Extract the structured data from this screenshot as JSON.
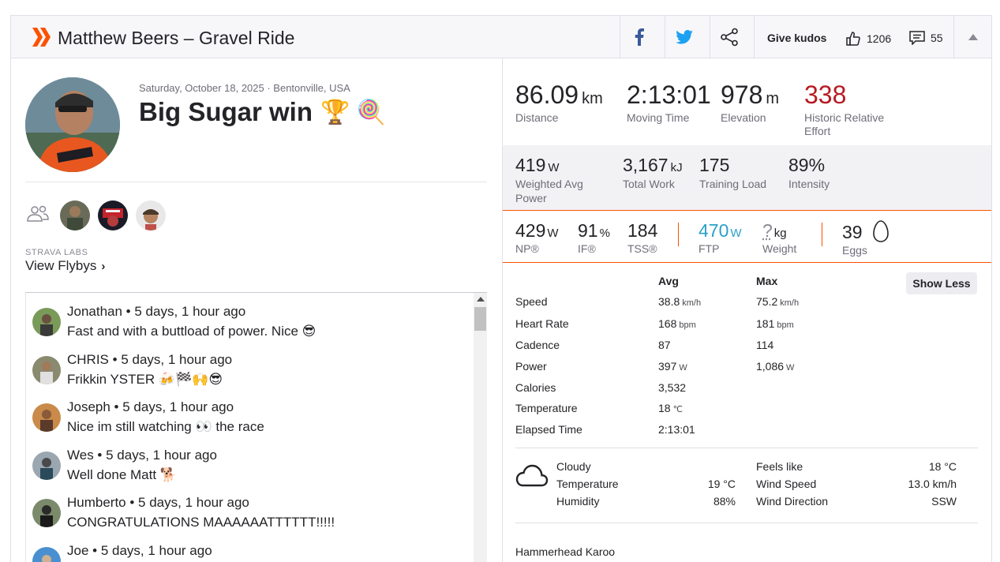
{
  "header": {
    "title": "Matthew Beers – Gravel Ride",
    "kudos_label": "Give kudos",
    "kudos_count": "1206",
    "comment_count": "55"
  },
  "activity": {
    "date_location": "Saturday, October 18, 2025 · Bentonville, USA",
    "title": "Big Sugar win",
    "title_emojis": "🏆 🍭",
    "strava_labs": "STRAVA LABS",
    "flybys": "View Flybys"
  },
  "comments": [
    {
      "name": "Jonathan",
      "time": "5 days, 1 hour ago",
      "text": "Fast and with a buttload of power. Nice 😎"
    },
    {
      "name": "CHRIS",
      "time": "5 days, 1 hour ago",
      "text": "Frikkin YSTER 🍻🏁🙌😎"
    },
    {
      "name": "Joseph",
      "time": "5 days, 1 hour ago",
      "text": "Nice im still watching 👀 the race"
    },
    {
      "name": "Wes",
      "time": "5 days, 1 hour ago",
      "text": "Well done Matt 🐕"
    },
    {
      "name": "Humberto",
      "time": "5 days, 1 hour ago",
      "text": "CONGRATULATIONS MAAAAAATTTTTT!!!!!"
    },
    {
      "name": "Joe",
      "time": "5 days, 1 hour ago",
      "text": ""
    }
  ],
  "big_stats": [
    {
      "value": "86.09",
      "unit": "km",
      "label": "Distance"
    },
    {
      "value": "2:13:01",
      "unit": "",
      "label": "Moving Time"
    },
    {
      "value": "978",
      "unit": "m",
      "label": "Elevation"
    },
    {
      "value": "338",
      "unit": "",
      "label": "Historic Relative Effort"
    }
  ],
  "secondary_stats": [
    {
      "value": "419",
      "unit": "W",
      "label": "Weighted Avg Power"
    },
    {
      "value": "3,167",
      "unit": "kJ",
      "label": "Total Work"
    },
    {
      "value": "175",
      "unit": "",
      "label": "Training Load"
    },
    {
      "value": "89%",
      "unit": "",
      "label": "Intensity"
    }
  ],
  "power_stats": [
    {
      "value": "429",
      "unit": "W",
      "label": "NP®"
    },
    {
      "value": "91",
      "unit": "%",
      "label": "IF®"
    },
    {
      "value": "184",
      "unit": "",
      "label": "TSS®"
    },
    {
      "value": "470",
      "unit": "W",
      "label": "FTP"
    },
    {
      "value": "?",
      "unit": "kg",
      "label": "Weight"
    },
    {
      "value": "39",
      "unit": "",
      "label": "Eggs"
    }
  ],
  "details": {
    "avg_header": "Avg",
    "max_header": "Max",
    "show_less": "Show Less",
    "rows": [
      {
        "label": "Speed",
        "avg": "38.8",
        "avg_unit": "km/h",
        "max": "75.2",
        "max_unit": "km/h"
      },
      {
        "label": "Heart Rate",
        "avg": "168",
        "avg_unit": "bpm",
        "max": "181",
        "max_unit": "bpm"
      },
      {
        "label": "Cadence",
        "avg": "87",
        "avg_unit": "",
        "max": "114",
        "max_unit": ""
      },
      {
        "label": "Power",
        "avg": "397",
        "avg_unit": "W",
        "max": "1,086",
        "max_unit": "W"
      },
      {
        "label": "Calories",
        "avg": "3,532",
        "avg_unit": "",
        "max": "",
        "max_unit": ""
      },
      {
        "label": "Temperature",
        "avg": "18",
        "avg_unit": "℃",
        "max": "",
        "max_unit": ""
      },
      {
        "label": "Elapsed Time",
        "avg": "2:13:01",
        "avg_unit": "",
        "max": "",
        "max_unit": ""
      }
    ]
  },
  "weather": {
    "condition": "Cloudy",
    "temperature_label": "Temperature",
    "temperature": "19 °C",
    "humidity_label": "Humidity",
    "humidity": "88%",
    "feels_like_label": "Feels like",
    "feels_like": "18 °C",
    "wind_speed_label": "Wind Speed",
    "wind_speed": "13.0 km/h",
    "wind_dir_label": "Wind Direction",
    "wind_dir": "SSW"
  },
  "device": "Hammerhead Karoo",
  "colors": {
    "strava_orange": "#fc5200",
    "relative_effort_red": "#b61b24",
    "ftp_blue": "#2aa0c8"
  },
  "icons": [
    "strava-chevrons-icon",
    "facebook-icon",
    "twitter-icon",
    "share-icon",
    "thumbs-up-icon",
    "comment-icon",
    "group-icon",
    "cloud-icon",
    "egg-icon",
    "collapse-caret-icon"
  ]
}
